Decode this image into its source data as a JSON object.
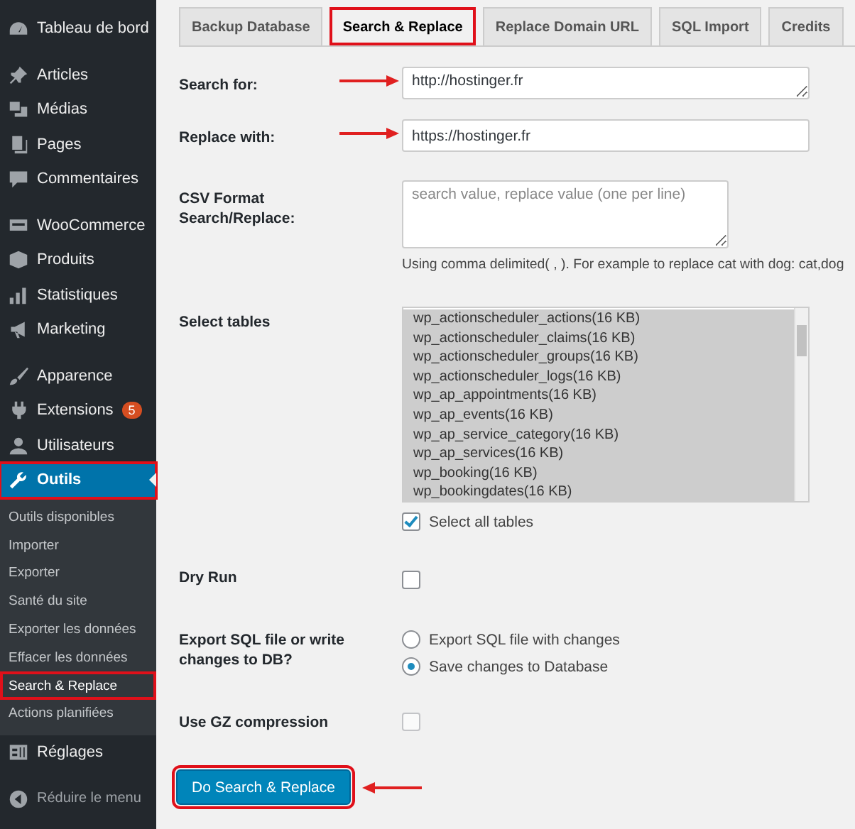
{
  "sidebar": {
    "groups": [
      [
        {
          "label": "Tableau de bord",
          "selected": false,
          "highlighted": false
        }
      ],
      [
        {
          "label": "Articles",
          "selected": false,
          "highlighted": false
        },
        {
          "label": "Médias",
          "selected": false,
          "highlighted": false
        },
        {
          "label": "Pages",
          "selected": false,
          "highlighted": false
        },
        {
          "label": "Commentaires",
          "selected": false,
          "highlighted": false
        }
      ],
      [
        {
          "label": "WooCommerce",
          "selected": false,
          "highlighted": false
        },
        {
          "label": "Produits",
          "selected": false,
          "highlighted": false
        },
        {
          "label": "Statistiques",
          "selected": false,
          "highlighted": false
        },
        {
          "label": "Marketing",
          "selected": false,
          "highlighted": false
        }
      ],
      [
        {
          "label": "Apparence",
          "selected": false,
          "highlighted": false
        },
        {
          "label": "Extensions",
          "badge": "5",
          "selected": false,
          "highlighted": false
        },
        {
          "label": "Utilisateurs",
          "selected": false,
          "highlighted": false
        },
        {
          "label": "Outils",
          "selected": true,
          "highlighted": true,
          "submenu": [
            {
              "label": "Outils disponibles",
              "selected": false,
              "highlighted": false
            },
            {
              "label": "Importer",
              "selected": false,
              "highlighted": false
            },
            {
              "label": "Exporter",
              "selected": false,
              "highlighted": false
            },
            {
              "label": "Santé du site",
              "selected": false,
              "highlighted": false
            },
            {
              "label": "Exporter les données",
              "selected": false,
              "highlighted": false
            },
            {
              "label": "Effacer les données",
              "selected": false,
              "highlighted": false
            },
            {
              "label": "Search & Replace",
              "selected": true,
              "highlighted": true
            },
            {
              "label": "Actions planifiées",
              "selected": false,
              "highlighted": false
            }
          ]
        },
        {
          "label": "Réglages",
          "selected": false,
          "highlighted": false
        }
      ]
    ],
    "collapse": "Réduire le menu"
  },
  "tabs": [
    {
      "label": "Backup Database",
      "selected": false,
      "highlighted": false
    },
    {
      "label": "Search & Replace",
      "selected": true,
      "highlighted": true
    },
    {
      "label": "Replace Domain URL",
      "selected": false,
      "highlighted": false
    },
    {
      "label": "SQL Import",
      "selected": false,
      "highlighted": false
    },
    {
      "label": "Credits",
      "selected": false,
      "highlighted": false
    }
  ],
  "form": {
    "search_for": {
      "label": "Search for:",
      "value": "http://hostinger.fr",
      "annotated": true
    },
    "replace_with": {
      "label": "Replace with:",
      "value": "https://hostinger.fr",
      "annotated": true
    },
    "csv": {
      "label": "CSV Format Search/Replace:",
      "placeholder": "search value, replace value (one per line)",
      "hint": "Using comma delimited( , ). For example to replace cat with dog: cat,dog"
    },
    "tables": {
      "label": "Select tables",
      "items": [
        {
          "name": "wp_actionscheduler_actions(16 KB)",
          "selected": true
        },
        {
          "name": "wp_actionscheduler_claims(16 KB)",
          "selected": true
        },
        {
          "name": "wp_actionscheduler_groups(16 KB)",
          "selected": true
        },
        {
          "name": "wp_actionscheduler_logs(16 KB)",
          "selected": true
        },
        {
          "name": "wp_ap_appointments(16 KB)",
          "selected": true
        },
        {
          "name": "wp_ap_events(16 KB)",
          "selected": true
        },
        {
          "name": "wp_ap_service_category(16 KB)",
          "selected": true
        },
        {
          "name": "wp_ap_services(16 KB)",
          "selected": true
        },
        {
          "name": "wp_booking(16 KB)",
          "selected": true
        },
        {
          "name": "wp_bookingdates(16 KB)",
          "selected": true
        }
      ],
      "select_all": {
        "label": "Select all tables",
        "checked": true
      }
    },
    "dry_run": {
      "label": "Dry Run",
      "checked": false
    },
    "export": {
      "label": "Export SQL file or write changes to DB?",
      "options": [
        {
          "label": "Export SQL file with changes",
          "selected": false
        },
        {
          "label": "Save changes to Database",
          "selected": true
        }
      ]
    },
    "gz": {
      "label": "Use GZ compression",
      "checked": false,
      "disabled": true
    },
    "submit": {
      "label": "Do Search & Replace",
      "highlighted": true,
      "annotated": true
    }
  }
}
